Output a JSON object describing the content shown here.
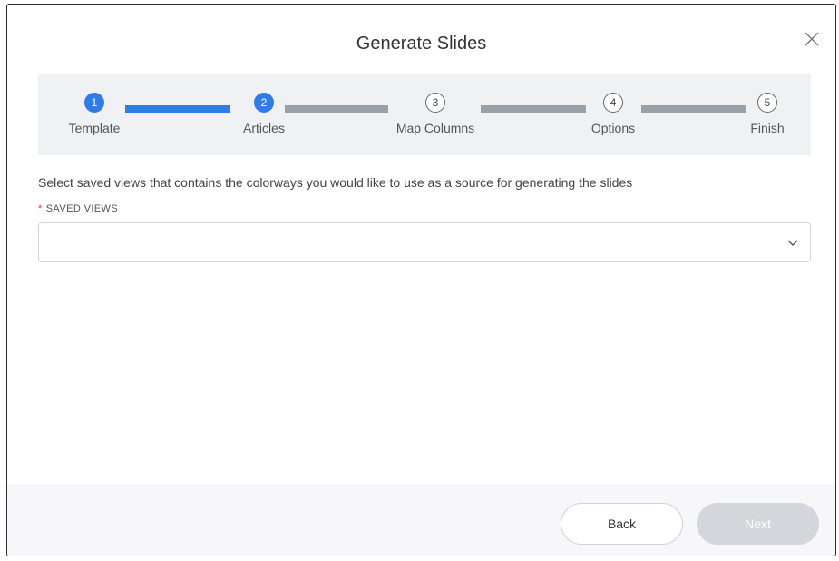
{
  "dialog": {
    "title": "Generate Slides",
    "close_icon": "close-icon"
  },
  "stepper": {
    "current_step": 2,
    "steps": [
      {
        "number": "1",
        "label": "Template",
        "state": "completed"
      },
      {
        "number": "2",
        "label": "Articles",
        "state": "active"
      },
      {
        "number": "3",
        "label": "Map Columns",
        "state": "pending"
      },
      {
        "number": "4",
        "label": "Options",
        "state": "pending"
      },
      {
        "number": "5",
        "label": "Finish",
        "state": "pending"
      }
    ],
    "colors": {
      "active": "#2f7ce8",
      "pending": "#9aa0a8"
    }
  },
  "main": {
    "description": "Select saved views that contains the colorways you would like to use as a source for generating the slides",
    "saved_views": {
      "required_marker": "*",
      "label": "SAVED VIEWS",
      "value": "",
      "icon": "chevron-down-icon"
    }
  },
  "footer": {
    "back_label": "Back",
    "next_label": "Next",
    "next_disabled": true
  }
}
